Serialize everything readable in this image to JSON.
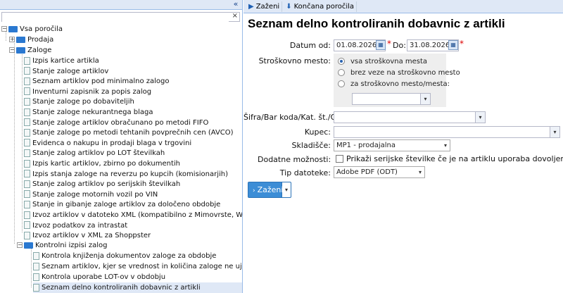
{
  "left_panel": {
    "collapse_label": "«",
    "search": {
      "value": "",
      "clear_label": "×"
    }
  },
  "tree": {
    "root": "Vsa poročila",
    "groups": {
      "prodaja": "Prodaja",
      "zaloge": "Zaloge"
    },
    "zaloge_items": [
      "Izpis kartice artikla",
      "Stanje zaloge artiklov",
      "Seznam artiklov pod minimalno zalogo",
      "Inventurni zapisnik za popis zalog",
      "Stanje zaloge po dobaviteljih",
      "Stanje zaloge nekurantnega blaga",
      "Stanje zaloge artiklov obračunano po metodi FIFO",
      "Stanje zaloge po metodi tehtanih povprečnih cen (AVCO)",
      "Evidenca o nakupu in prodaji blaga v trgovini",
      "Stanje zalog artiklov po LOT številkah",
      "Izpis kartic artiklov, zbirno po dokumentih",
      "Izpis stanja zaloge na reverzu po kupcih (komisionarjih)",
      "Stanje zalog artiklov po serijskih številkah",
      "Stanje zaloge motornih vozil po VIN",
      "Stanje in gibanje zaloge artiklov za določeno obdobje",
      "Izvoz artiklov v datoteko XML (kompatibilno z Mimovrste, Wolt,...)",
      "Izvoz podatkov za intrastat",
      "Izvoz artiklov v XML za Shoppster"
    ],
    "kontrolni_group": "Kontrolni izpisi zalog",
    "kontrolni_items": [
      "Kontrola knjiženja dokumentov zaloge za obdobje",
      "Seznam artiklov, kjer se vrednost in količina zaloge ne ujema (preos",
      "Kontrola uporabe LOT-ov v obdobju",
      "Seznam delno kontroliranih dobavnic z artikli"
    ]
  },
  "toolbar": {
    "run_label": "Zaženi",
    "finished_label": "Končana poročila"
  },
  "form": {
    "title": "Seznam delno kontroliranih dobavnic z artikli",
    "date_from_label": "Datum od:",
    "date_from_value": "01.08.2026",
    "date_to_label": "Do:",
    "date_to_value": "31.08.2026",
    "required_mark": "*",
    "cost_center_label": "Stroškovno mesto:",
    "cost_center_options": [
      "vsa stroškovna mesta",
      "brez veze na stroškovno mesto",
      "za stroškovno mesto/mesta:"
    ],
    "cost_center_selected": "vsa stroškovna mesta",
    "cost_center_select_value": "",
    "article_label": "Šifra/Bar koda/Kat. št./Opis:",
    "article_value": "",
    "customer_label": "Kupec:",
    "customer_value": "",
    "warehouse_label": "Skladišče:",
    "warehouse_value": "MP1 - prodajalna",
    "extra_label": "Dodatne možnosti:",
    "extra_checkbox_label": "Prikaži serijske številke če je na artiklu uporaba dovoljena",
    "extra_checkbox_checked": false,
    "filetype_label": "Tip datoteke:",
    "filetype_value": "Adobe PDF (ODT)",
    "run_button_label": "Zaženi"
  },
  "colors": {
    "accent": "#3c8dd6",
    "header_bg": "#dfe8f6",
    "folder": "#2a78d0",
    "required": "#dd0000"
  }
}
